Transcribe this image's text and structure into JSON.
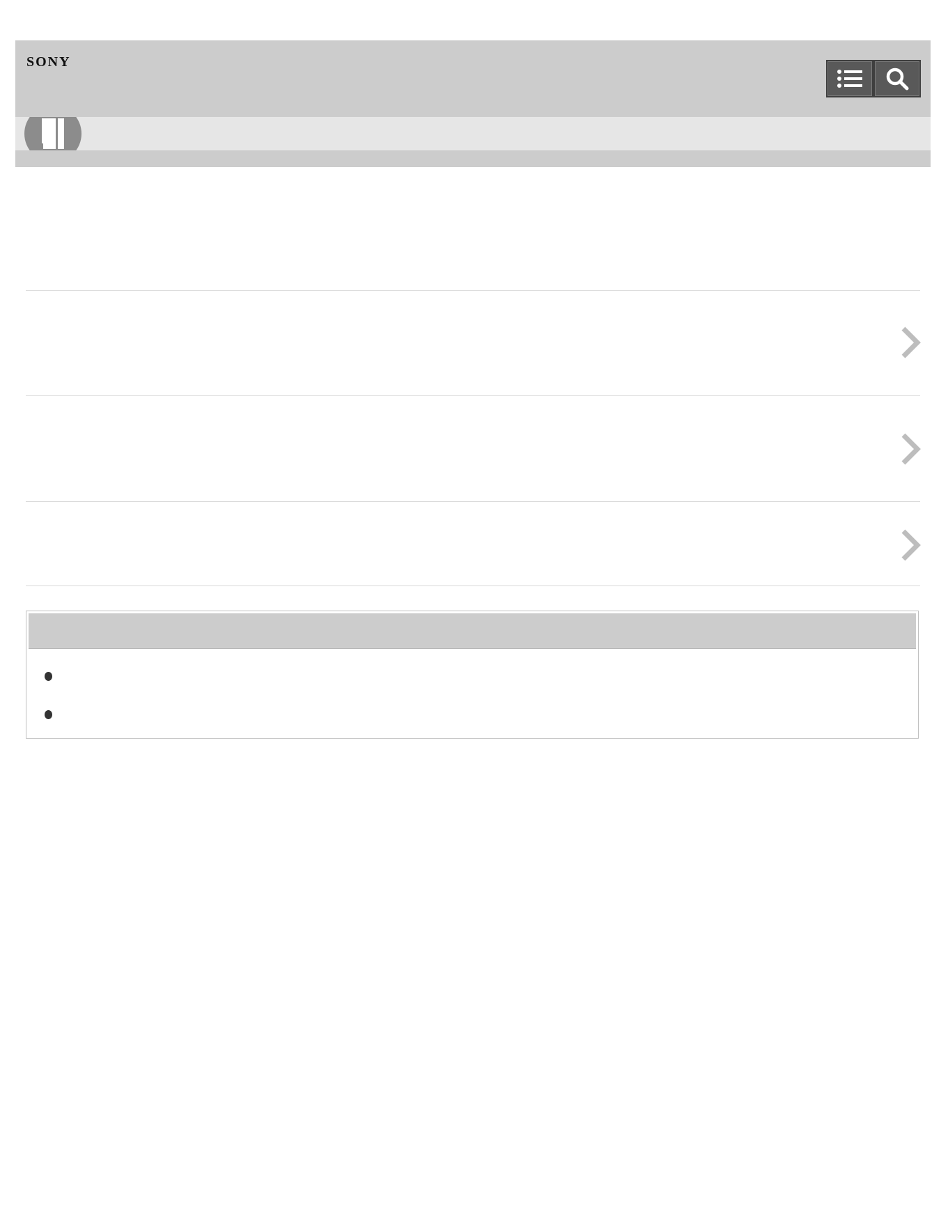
{
  "header": {
    "brand": "SONY",
    "toc_button_icon": "list-icon",
    "search_button_icon": "search-icon",
    "background_color": "#cccccc",
    "button_color": "#595959"
  },
  "subheader": {
    "badge_icon": "book-icon",
    "background_color": "#e6e6e6"
  },
  "links": [
    {
      "chevron_icon": "chevron-right-icon"
    },
    {
      "chevron_icon": "chevron-right-icon"
    },
    {
      "chevron_icon": "chevron-right-icon"
    }
  ],
  "notes": {
    "bullet_count": 2
  },
  "colors": {
    "divider": "#d9d9d9",
    "chevron": "#bdbdbd"
  }
}
